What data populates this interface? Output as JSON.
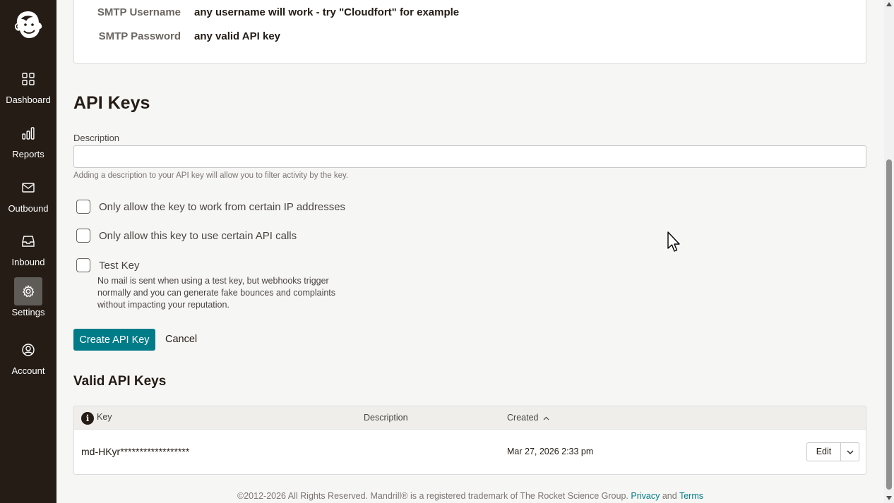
{
  "sidebar": {
    "items": [
      {
        "label": "Dashboard",
        "icon": "grid-icon"
      },
      {
        "label": "Reports",
        "icon": "bar-chart-icon"
      },
      {
        "label": "Outbound",
        "icon": "envelope-icon"
      },
      {
        "label": "Inbound",
        "icon": "inbox-icon"
      },
      {
        "label": "Settings",
        "icon": "gear-icon",
        "active": true
      },
      {
        "label": "Account",
        "icon": "user-circle-icon"
      }
    ]
  },
  "smtp": {
    "username_label": "SMTP Username",
    "username_value": "any username will work - try \"Cloudfort\" for example",
    "password_label": "SMTP Password",
    "password_value": "any valid API key"
  },
  "api_keys": {
    "title": "API Keys",
    "description_label": "Description",
    "description_value": "",
    "description_help": "Adding a description to your API key will allow you to filter activity by the key.",
    "options": [
      {
        "label": "Only allow the key to work from certain IP addresses",
        "checked": false
      },
      {
        "label": "Only allow this key to use certain API calls",
        "checked": false
      },
      {
        "label": "Test Key",
        "checked": false
      }
    ],
    "test_key_note": "No mail is sent when using a test key, but webhooks trigger normally and you can generate fake bounces and complaints without impacting your reputation.",
    "create_button": "Create API Key",
    "cancel_button": "Cancel"
  },
  "valid_keys": {
    "title": "Valid API Keys",
    "columns": {
      "key": "Key",
      "description": "Description",
      "created": "Created"
    },
    "info_icon_glyph": "i",
    "rows": [
      {
        "key": "md-HKyr******************",
        "description": "",
        "created": "Mar 27, 2026 2:33 pm",
        "action": "Edit"
      }
    ]
  },
  "footer": {
    "text": "©2012-2026 All Rights Reserved. Mandrill® is a registered trademark of The Rocket Science Group.",
    "privacy": "Privacy",
    "and": "and",
    "terms": "Terms"
  },
  "colors": {
    "sidebar_bg": "#241c15",
    "accent": "#007c89",
    "page_bg": "#f6f6f4"
  }
}
